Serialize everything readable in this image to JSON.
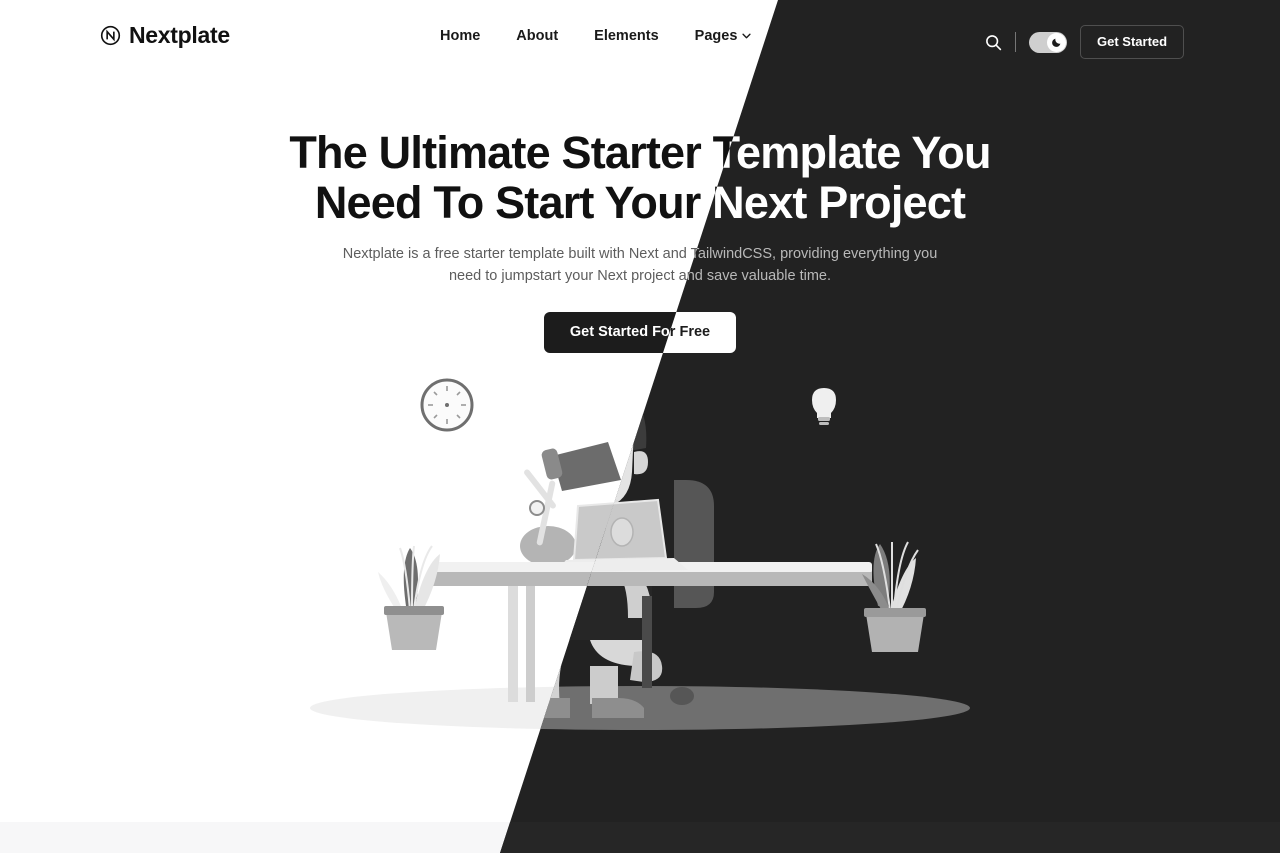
{
  "brand": {
    "name": "Nextplate",
    "logo_icon": "circled-n-logo-icon"
  },
  "nav": {
    "items": [
      {
        "label": "Home",
        "has_dropdown": false
      },
      {
        "label": "About",
        "has_dropdown": false
      },
      {
        "label": "Elements",
        "has_dropdown": false
      },
      {
        "label": "Pages",
        "has_dropdown": true
      }
    ]
  },
  "header_actions": {
    "search_icon": "search-icon",
    "theme_toggle": {
      "state": "dark",
      "knob_icon": "moon-icon"
    },
    "get_started_label": "Get Started"
  },
  "hero": {
    "headline_line1": "The Ultimate Starter Template You",
    "headline_line2": "Need To Start Your Next Project",
    "subtext": "Nextplate is a free starter template built with Next and TailwindCSS, providing everything you need to jumpstart your Next project and save valuable time.",
    "cta_label": "Get Started For Free",
    "illustration": "developer-at-desk-illustration"
  },
  "colors": {
    "light_bg": "#ffffff",
    "dark_bg": "#222222",
    "dark_bg_lower": "#262626",
    "next_section_bg": "#f7f7f8",
    "text_dark": "#111111",
    "text_light": "#ffffff",
    "muted_light": "#5d5d5d",
    "muted_dark": "#b9b9b9",
    "toggle_track": "#cfcfcf",
    "outline_border_light": "#cfcfcf",
    "outline_border_dark": "#4f4f4f"
  }
}
